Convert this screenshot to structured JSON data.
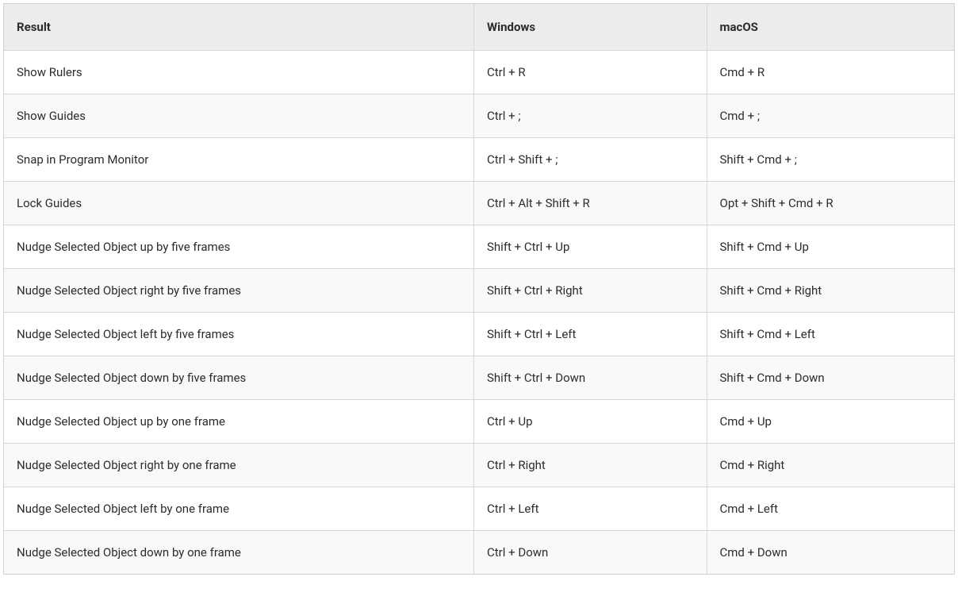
{
  "table": {
    "headers": {
      "result": "Result",
      "windows": "Windows",
      "macos": "macOS"
    },
    "rows": [
      {
        "result": "Show Rulers",
        "windows": "Ctrl + R",
        "macos": "Cmd + R"
      },
      {
        "result": "Show Guides",
        "windows": "Ctrl + ;",
        "macos": "Cmd + ;"
      },
      {
        "result": "Snap in Program Monitor",
        "windows": "Ctrl + Shift + ;",
        "macos": "Shift + Cmd + ;"
      },
      {
        "result": "Lock Guides",
        "windows": "Ctrl + Alt + Shift + R",
        "macos": "Opt + Shift + Cmd + R"
      },
      {
        "result": "Nudge Selected Object up by five frames",
        "windows": "Shift + Ctrl + Up",
        "macos": "Shift + Cmd + Up"
      },
      {
        "result": "Nudge Selected Object right by five frames",
        "windows": "Shift + Ctrl + Right",
        "macos": "Shift + Cmd + Right"
      },
      {
        "result": "Nudge Selected Object left by five frames",
        "windows": "Shift + Ctrl + Left",
        "macos": "Shift + Cmd + Left"
      },
      {
        "result": "Nudge Selected Object down by five frames",
        "windows": "Shift + Ctrl + Down",
        "macos": "Shift + Cmd + Down"
      },
      {
        "result": "Nudge Selected Object up by one frame",
        "windows": "Ctrl + Up",
        "macos": "Cmd + Up"
      },
      {
        "result": "Nudge Selected Object right by one frame",
        "windows": "Ctrl + Right",
        "macos": "Cmd + Right"
      },
      {
        "result": "Nudge Selected Object left by one frame",
        "windows": "Ctrl + Left",
        "macos": "Cmd + Left"
      },
      {
        "result": "Nudge Selected Object down by one frame",
        "windows": "Ctrl + Down",
        "macos": "Cmd + Down"
      }
    ]
  }
}
